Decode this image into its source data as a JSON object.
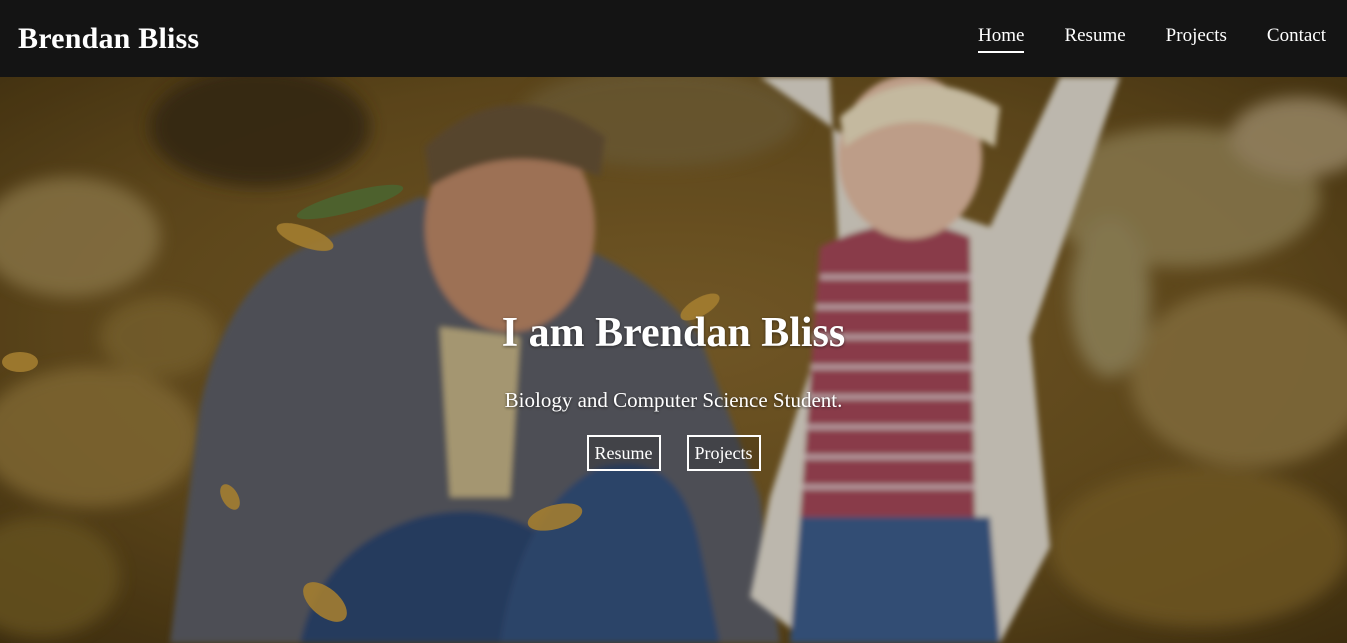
{
  "header": {
    "brand": "Brendan Bliss",
    "nav": [
      {
        "label": "Home",
        "active": true
      },
      {
        "label": "Resume",
        "active": false
      },
      {
        "label": "Projects",
        "active": false
      },
      {
        "label": "Contact",
        "active": false
      }
    ]
  },
  "hero": {
    "title": "I am Brendan Bliss",
    "subtitle": "Biology and Computer Science Student.",
    "buttons": [
      {
        "label": "Resume"
      },
      {
        "label": "Projects"
      }
    ]
  },
  "colors": {
    "navbar_bg": "#141414",
    "text": "#ffffff"
  }
}
